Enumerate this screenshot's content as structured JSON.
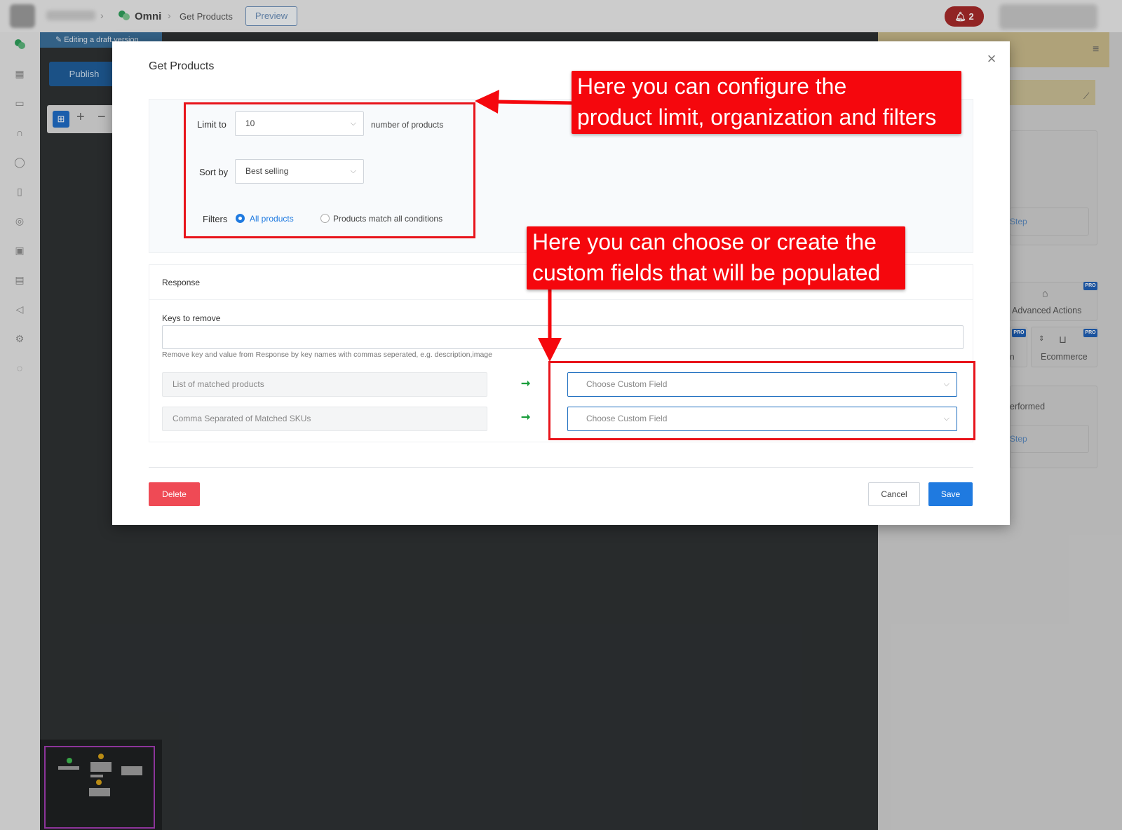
{
  "topbar": {
    "app_name": "Omni",
    "page_name": "Get Products",
    "preview_label": "Preview",
    "notification_count": "2"
  },
  "canvas": {
    "draft_banner": "Editing a draft version",
    "publish_label": "Publish"
  },
  "right_panel": {
    "step_link_1": "Step",
    "advanced_actions": "Advanced Actions",
    "ecommerce": "Ecommerce",
    "partial_label_on": "n",
    "performed_text": "erformed",
    "step_link_2": "Step",
    "pro_badge": "PRO"
  },
  "modal": {
    "title": "Get Products",
    "limit_label": "Limit to",
    "limit_value": "10",
    "limit_suffix": "number of products",
    "sort_label": "Sort by",
    "sort_value": "Best selling",
    "filters_label": "Filters",
    "filter_options": [
      "All products",
      "Products match all conditions"
    ],
    "selected_filter": "All products",
    "response_title": "Response",
    "keys_label": "Keys to remove",
    "keys_value": "",
    "keys_help": "Remove key and value from Response by key names with commas seperated, e.g. description,image",
    "mappings": [
      {
        "source": "List of matched products",
        "target_placeholder": "Choose Custom Field"
      },
      {
        "source": "Comma Separated of Matched SKUs",
        "target_placeholder": "Choose Custom Field"
      }
    ],
    "delete_label": "Delete",
    "cancel_label": "Cancel",
    "save_label": "Save"
  },
  "annotations": {
    "callout_1_line1": "Here you can configure the",
    "callout_1_line2": "product limit, organization and filters",
    "callout_2_line1": "Here you can choose or create the",
    "callout_2_line2": "custom fields that will be populated"
  },
  "colors": {
    "primary": "#1f7ae0",
    "danger": "#ef4a55",
    "annotation_red": "#f5070d",
    "map_arrow_green": "#1a9e3c"
  },
  "icons": [
    "chevron-right-icon",
    "chat-bubbles-icon",
    "bell-icon",
    "close-icon",
    "chevron-down-icon",
    "arrow-right-icon",
    "edit-icon",
    "menu-icon",
    "cart-icon",
    "box-icon"
  ]
}
